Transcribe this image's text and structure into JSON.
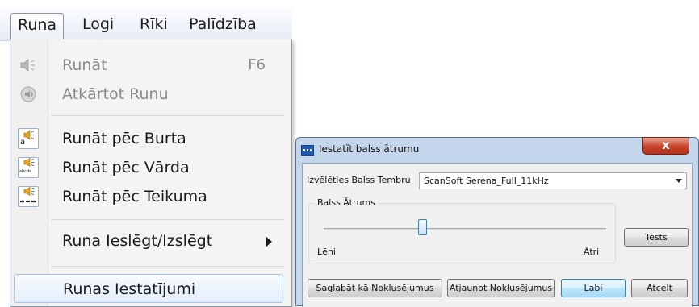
{
  "menubar": {
    "items": [
      {
        "label": "Runa",
        "active": true
      },
      {
        "label": "Logi"
      },
      {
        "label": "Rīki"
      },
      {
        "label": "Palīdzība"
      }
    ]
  },
  "menu": {
    "items": [
      {
        "label": "Runāt",
        "shortcut": "F6",
        "disabled": true,
        "icon": "speaker-muted-icon"
      },
      {
        "label": "Atkārtot Runu",
        "disabled": true,
        "icon": "repeat-speech-icon"
      },
      {
        "label": "Runāt pēc Burta",
        "icon": "speak-by-letter-icon",
        "icon_caption": "a"
      },
      {
        "label": "Runāt pēc Vārda",
        "icon": "speak-by-word-icon",
        "icon_caption": "abcde"
      },
      {
        "label": "Runāt pēc Teikuma",
        "icon": "speak-by-sentence-icon"
      },
      {
        "label": "Runa Ieslēgt/Izslēgt",
        "submenu": true
      },
      {
        "label": "Runas Iestatījumi",
        "highlighted": true
      }
    ]
  },
  "dialog": {
    "title": "Iestatīt balss ātrumu",
    "close_label": "x",
    "voice_label": "Izvēlēties Balss Tembru",
    "voice_value": "ScanSoft Serena_Full_11kHz",
    "speed_group_label": "Balss Ātrums",
    "speed_value": 0.35,
    "slow_label": "Lēni",
    "fast_label": "Ātri",
    "test_button": "Tests",
    "save_default_button": "Saglabāt kā Noklusējumus",
    "restore_default_button": "Atjaunot Noklusējumus",
    "ok_button": "Labi",
    "cancel_button": "Atcelt"
  },
  "colors": {
    "dialog_frame": "#c3d6ec",
    "close_button": "#c9422a",
    "default_button": "#a7d9f5",
    "menu_highlight": "#e4eefb",
    "speaker_icon": "#e8a31c"
  }
}
